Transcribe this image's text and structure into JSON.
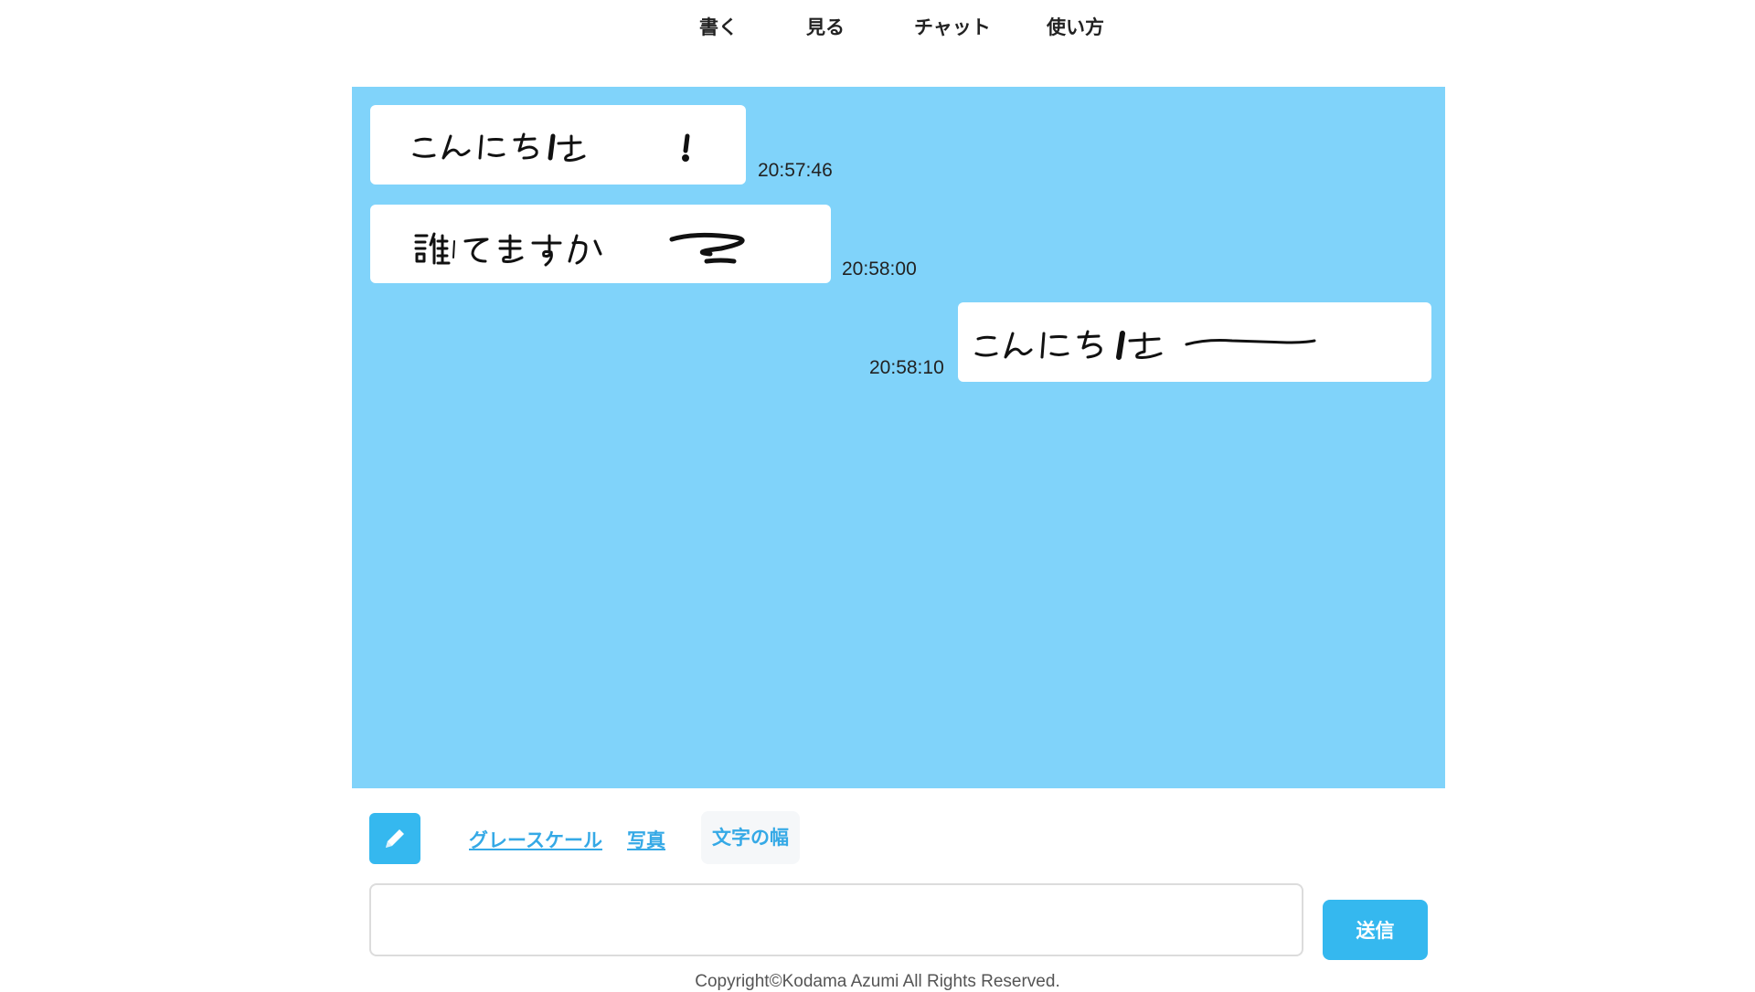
{
  "nav": {
    "items": [
      {
        "label": "書く"
      },
      {
        "label": "見る"
      },
      {
        "label": "チャット"
      },
      {
        "label": "使い方"
      }
    ]
  },
  "chat": {
    "background": "#80d3fa",
    "messages": [
      {
        "side": "left",
        "handwritten_text": "こんにちは！",
        "time": "20:57:46"
      },
      {
        "side": "left",
        "handwritten_text": "誰かいますか？",
        "time": "20:58:00"
      },
      {
        "side": "right",
        "handwritten_text": "こんにちは―",
        "time": "20:58:10"
      }
    ]
  },
  "toolbar": {
    "pen_icon": "pencil-icon",
    "grayscale_label": "グレースケール",
    "photo_label": "写真",
    "width_label": "文字の幅"
  },
  "composer": {
    "value": "",
    "placeholder": "",
    "send_label": "送信"
  },
  "footer": {
    "copyright": "Copyright©Kodama Azumi All Rights Reserved."
  },
  "colors": {
    "accent": "#35b8ef",
    "link": "#35a9e6",
    "chat_bg": "#80d3fa"
  }
}
